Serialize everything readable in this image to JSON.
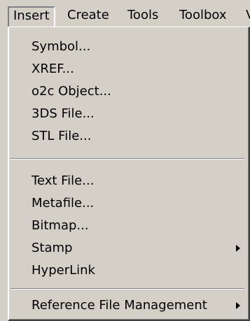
{
  "menubar": {
    "items": [
      {
        "label": "Insert"
      },
      {
        "label": "Create"
      },
      {
        "label": "Tools"
      },
      {
        "label": "Toolbox"
      },
      {
        "label": "V"
      }
    ]
  },
  "dropdown": {
    "groups": [
      [
        "Symbol...",
        "XREF...",
        "o2c Object...",
        "3DS File...",
        "STL File..."
      ],
      [
        "Text File...",
        "Metafile...",
        "Bitmap...",
        "Stamp",
        "HyperLink"
      ],
      [
        "Reference File Management"
      ]
    ],
    "items": {
      "symbol": "Symbol...",
      "xref": "XREF...",
      "o2c": "o2c Object...",
      "threeds": "3DS File...",
      "stl": "STL File...",
      "textfile": "Text File...",
      "metafile": "Metafile...",
      "bitmap": "Bitmap...",
      "stamp": "Stamp",
      "hyperlink": "HyperLink",
      "reffile": "Reference File Management"
    }
  }
}
